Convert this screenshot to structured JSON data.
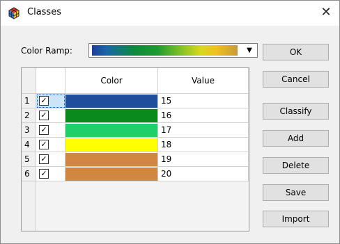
{
  "window": {
    "title": "Classes",
    "close_glyph": "✕"
  },
  "ramp": {
    "label": "Color Ramp:",
    "arrow": "▼"
  },
  "table": {
    "headers": {
      "color": "Color",
      "value": "Value"
    },
    "rows": [
      {
        "num": "1",
        "checked": "✓",
        "color": "#1f4e9c",
        "value": "15"
      },
      {
        "num": "2",
        "checked": "✓",
        "color": "#0a8a1c",
        "value": "16"
      },
      {
        "num": "3",
        "checked": "✓",
        "color": "#1fcf6a",
        "value": "17"
      },
      {
        "num": "4",
        "checked": "✓",
        "color": "#ffff00",
        "value": "18"
      },
      {
        "num": "5",
        "checked": "✓",
        "color": "#d18641",
        "value": "19"
      },
      {
        "num": "6",
        "checked": "✓",
        "color": "#d18641",
        "value": "20"
      }
    ]
  },
  "buttons": {
    "ok": "OK",
    "cancel": "Cancel",
    "classify": "Classify",
    "add": "Add",
    "delete": "Delete",
    "save": "Save",
    "import": "Import"
  },
  "icons": {
    "app": "colorful-cube-icon",
    "close": "close-icon",
    "dropdown": "chevron-down-icon",
    "checkbox": "checkmark-icon"
  }
}
